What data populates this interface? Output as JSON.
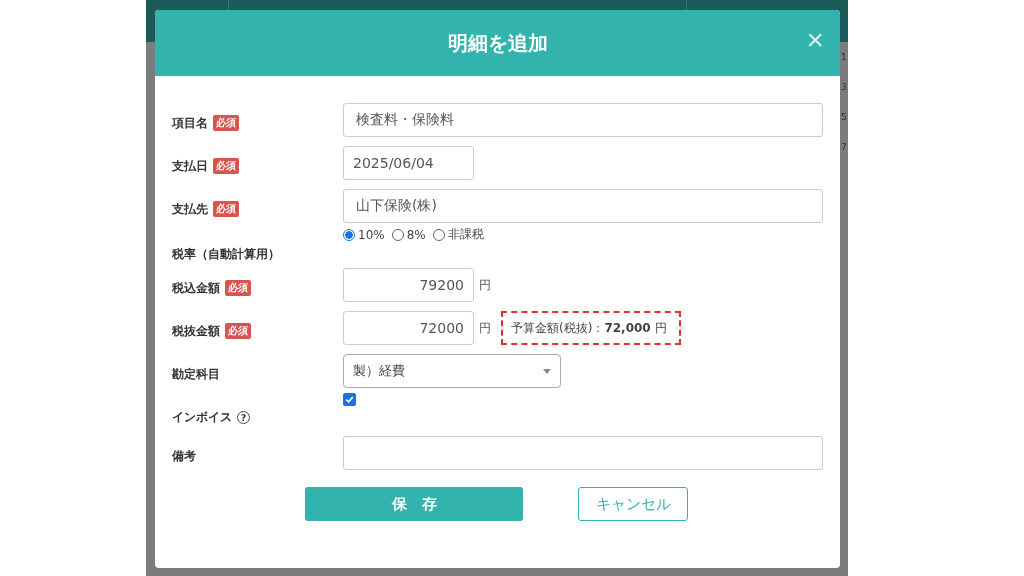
{
  "background": {
    "row_numbers": [
      "1",
      "3",
      "5",
      "7"
    ]
  },
  "dialog": {
    "title": "明細を追加",
    "close": "×"
  },
  "fields": [
    {
      "kind": "text",
      "label": "項目名",
      "badge": "必須",
      "value": "検査料・保険料"
    },
    {
      "kind": "date",
      "label": "支払日",
      "badge": "必須",
      "value": "2025/06/04"
    },
    {
      "kind": "text",
      "label": "支払先",
      "badge": "必須",
      "value": "山下保険(株)"
    },
    {
      "kind": "radio",
      "label": "税率（自動計算用）",
      "options": [
        {
          "label": "10%",
          "selected": true
        },
        {
          "label": "8%",
          "selected": false
        },
        {
          "label": "非課税",
          "selected": false
        }
      ]
    },
    {
      "kind": "amount",
      "label": "税込金額",
      "badge": "必須",
      "value": "79200",
      "unit": "円"
    },
    {
      "kind": "amount",
      "label": "税抜金額",
      "badge": "必須",
      "value": "72000",
      "unit": "円",
      "note": "予算金額(税抜)：**72,000** 円"
    },
    {
      "kind": "select",
      "label": "勘定科目",
      "value": "製）経費"
    },
    {
      "kind": "checkbox",
      "label": "インボイス",
      "help": "?",
      "checked": true
    },
    {
      "kind": "text",
      "label": "備考"
    }
  ],
  "buttons": [
    {
      "kind": "primary",
      "label": "保　存"
    },
    {
      "kind": "secondary",
      "label": "キャンセル"
    }
  ]
}
